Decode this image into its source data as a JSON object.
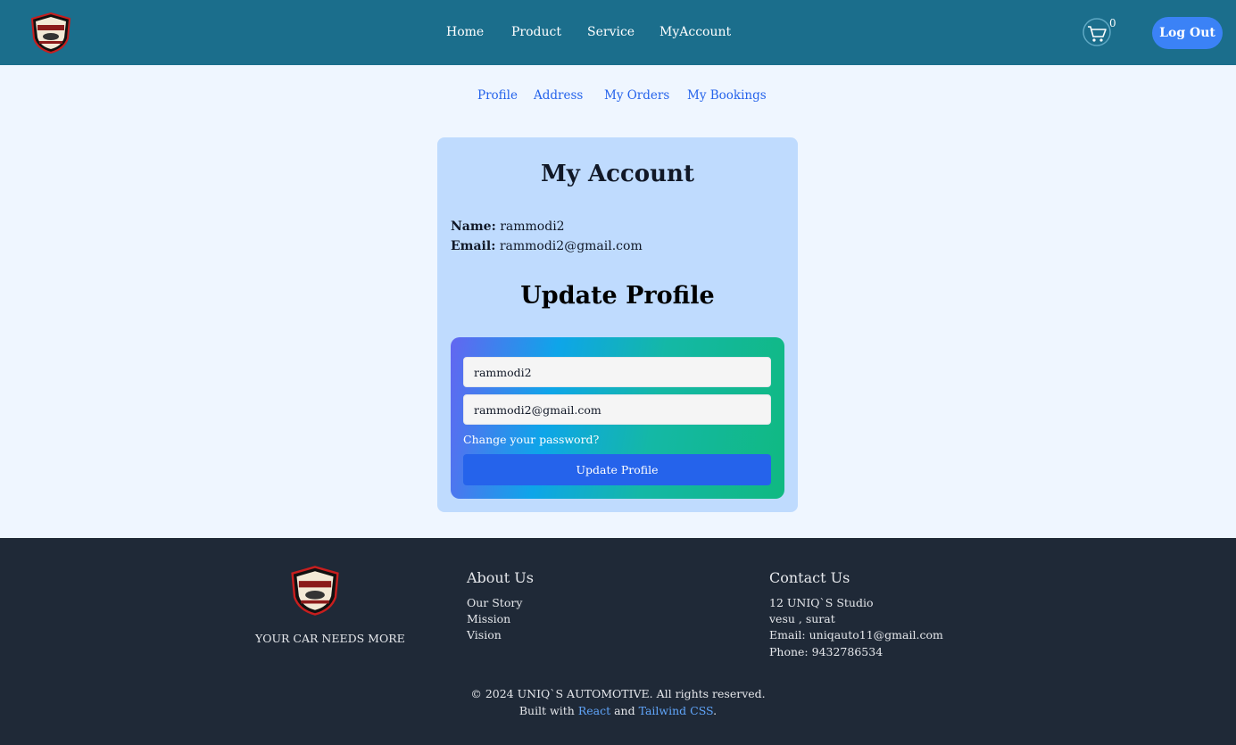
{
  "header": {
    "logo_alt": "UNIQ'S AUTOMOTIVE",
    "nav": [
      "Home",
      "Product",
      "Service",
      "MyAccount"
    ],
    "cart_count": "0",
    "logout_label": "Log Out"
  },
  "subnav": [
    "Profile",
    "Address",
    "My Orders",
    "My Bookings"
  ],
  "account": {
    "title": "My Account",
    "name_label": "Name:",
    "name_value": "rammodi2",
    "email_label": "Email:",
    "email_value": "rammodi2@gmail.com"
  },
  "update": {
    "title": "Update Profile",
    "name_input": "rammodi2",
    "email_input": "rammodi2@gmail.com",
    "change_password": "Change your password?",
    "button": "Update Profile"
  },
  "footer": {
    "tagline": "YOUR CAR NEEDS MORE",
    "about_title": "About Us",
    "about_links": [
      "Our Story",
      "Mission",
      "Vision"
    ],
    "contact_title": "Contact Us",
    "contact_lines": [
      "12 UNIQ`S Studio",
      "vesu , surat",
      "Email: uniqauto11@gmail.com",
      "Phone: 9432786534"
    ],
    "copyright": "© 2024 UNIQ`S AUTOMOTIVE. All rights reserved.",
    "built_prefix": "Built with",
    "built_react": "React",
    "built_and": "and",
    "built_tailwind": "Tailwind CSS",
    "built_suffix": "."
  },
  "colors": {
    "header_bg": "#1b6e8c",
    "page_bg": "#eff6ff",
    "card_bg": "#bfdbfe",
    "button_blue": "#2563eb",
    "footer_bg": "#1f2937"
  }
}
